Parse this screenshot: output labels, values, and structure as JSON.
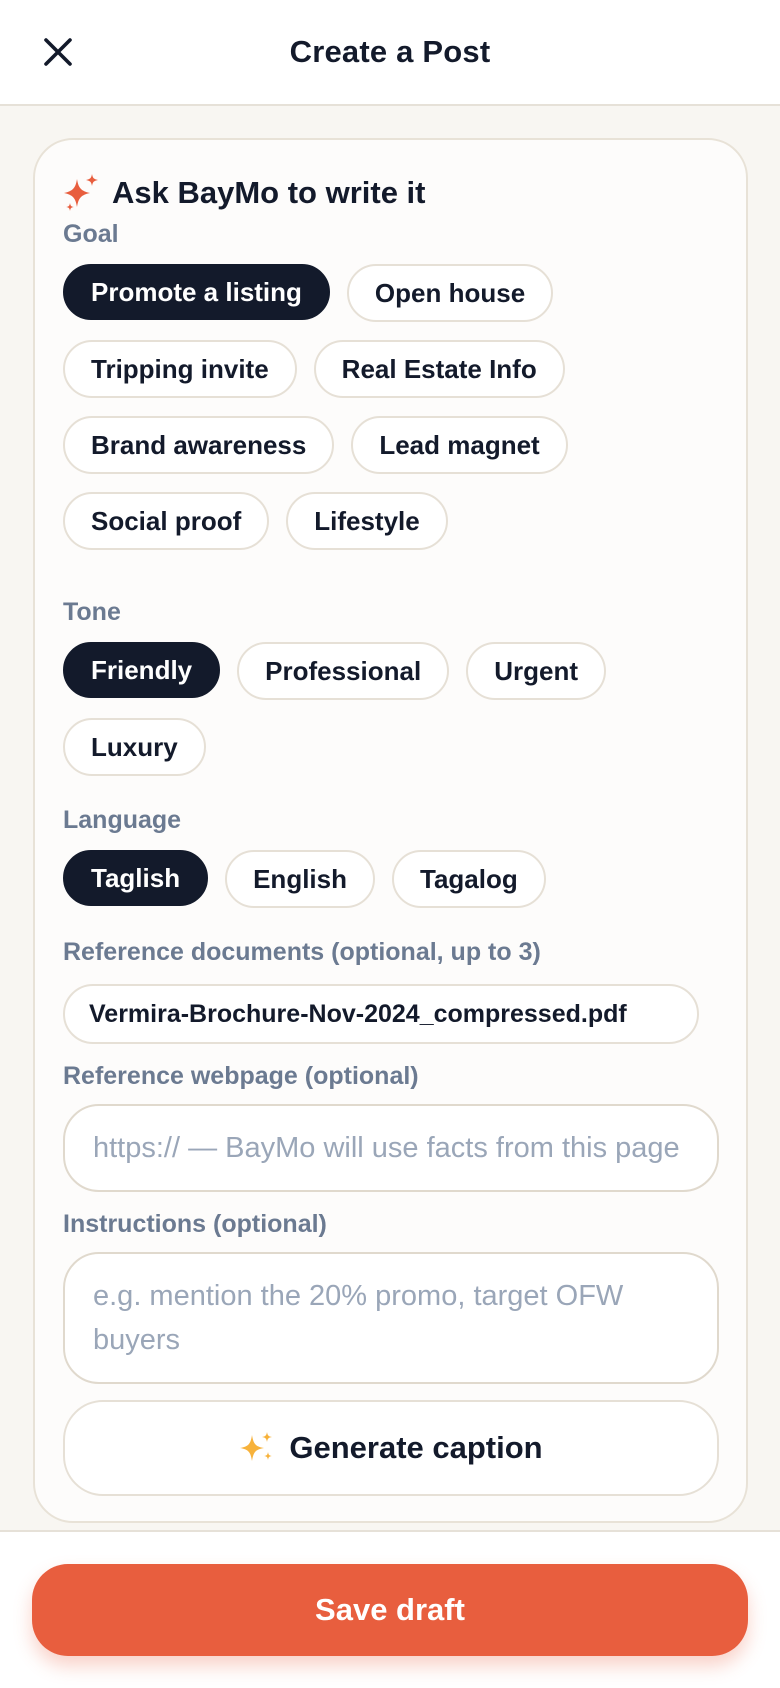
{
  "header": {
    "title": "Create a Post",
    "close_icon": "close-icon"
  },
  "ai_card": {
    "title": "Ask BayMo to write it",
    "sparkle_icon": "sparkle-icon",
    "goal": {
      "label": "Goal",
      "options": [
        "Promote a listing",
        "Open house",
        "Tripping invite",
        "Real Estate Info",
        "Brand awareness",
        "Lead magnet",
        "Social proof",
        "Lifestyle"
      ],
      "selected": "Promote a listing"
    },
    "tone": {
      "label": "Tone",
      "options": [
        "Friendly",
        "Professional",
        "Urgent",
        "Luxury"
      ],
      "selected": "Friendly"
    },
    "language": {
      "label": "Language",
      "options": [
        "Taglish",
        "English",
        "Tagalog"
      ],
      "selected": "Taglish"
    },
    "reference_documents": {
      "label": "Reference documents (optional, up to 3)",
      "files": [
        "Vermira-Brochure-Nov-2024_compressed.pdf"
      ]
    },
    "reference_webpage": {
      "label": "Reference webpage (optional)",
      "value": "",
      "placeholder": "https:// — BayMo will use facts from this page"
    },
    "instructions": {
      "label": "Instructions (optional)",
      "value": "",
      "placeholder": "e.g. mention the 20% promo, target OFW buyers"
    },
    "generate_button": {
      "label": "Generate caption",
      "icon": "sparkles-emoji-icon"
    }
  },
  "footer": {
    "save_label": "Save draft"
  },
  "colors": {
    "accent": "#e85e3e",
    "selected_chip": "#131a2b",
    "label": "#6b7a91"
  }
}
